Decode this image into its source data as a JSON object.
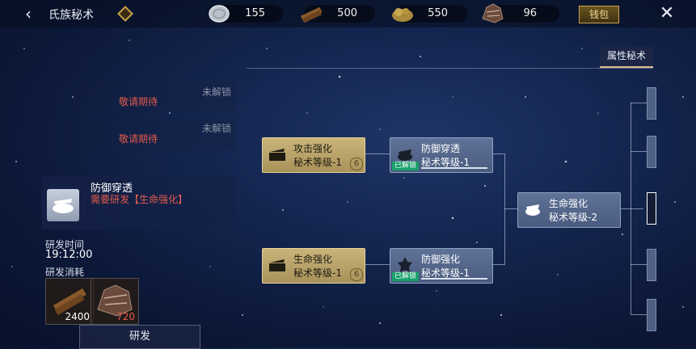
{
  "header": {
    "title": "氏族秘术",
    "resources": [
      {
        "icon": "silver-coin-icon",
        "value": "155"
      },
      {
        "icon": "wood-log-icon",
        "value": "500"
      },
      {
        "icon": "ore-icon",
        "value": "550"
      },
      {
        "icon": "fur-hide-icon",
        "value": "96"
      }
    ],
    "wallet_label": "钱包"
  },
  "tabs": [
    {
      "label": "属性秘术",
      "active": true
    }
  ],
  "locked_slots": [
    {
      "text": "敬请期待",
      "status": "未解锁"
    },
    {
      "text": "敬请期待",
      "status": "未解锁"
    }
  ],
  "detail": {
    "name": "防御穿透",
    "requirement": "需要研发【生命强化】",
    "research_time_label": "研发时间",
    "research_time_value": "19:12:00",
    "cost_label": "研发消耗",
    "costs": [
      {
        "icon": "wood-log-icon",
        "value": "2400",
        "color": "#ffffff"
      },
      {
        "icon": "fur-hide-icon",
        "value": "720",
        "color": "#e35c4c"
      }
    ],
    "research_button": "研发"
  },
  "tree": {
    "nodes": [
      {
        "name": "攻击强化",
        "level": "秘术等级-1",
        "style": "gold",
        "icon": "attack-boost-icon",
        "number": "6"
      },
      {
        "name": "防御穿透",
        "level": "秘术等级-1",
        "style": "blue",
        "icon": "armor-pierce-icon",
        "badge": "已解锁",
        "progress": 1.0
      },
      {
        "name": "生命强化",
        "level": "秘术等级-1",
        "style": "gold",
        "icon": "life-boost-icon",
        "number": "6"
      },
      {
        "name": "防御强化",
        "level": "秘术等级-1",
        "style": "blue",
        "icon": "defense-boost-icon",
        "badge": "已解锁",
        "progress": 1.0
      },
      {
        "name": "生命强化",
        "level": "秘术等级-2",
        "style": "blue",
        "icon": "life-boost-icon"
      }
    ]
  },
  "colors": {
    "gold_node": "#c9b47a",
    "blue_node": "#5f7297",
    "unlocked_badge": "#16a06a",
    "warning_text": "#e35c4c"
  }
}
